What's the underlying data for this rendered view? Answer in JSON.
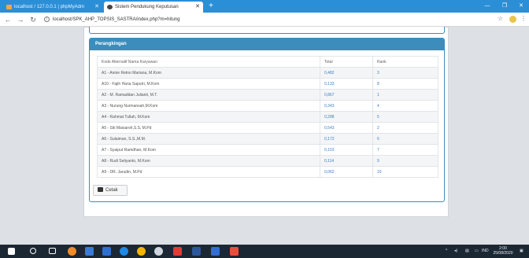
{
  "browser": {
    "tabs": [
      {
        "label": "localhost / 127.0.0.1 | phpMyAdm"
      },
      {
        "label": "Sistem Pendukung Keputusan"
      }
    ],
    "url": "localhost/SPK_AHP_TOPSIS_SASTRA/index.php?m=hitung"
  },
  "panel": {
    "title": "Perangkingan",
    "columns": [
      "Kode Alternatif Nama Karyawan",
      "Total",
      "Rank"
    ],
    "rows": [
      {
        "name": "A1 - Annie Retno Mariana, M.Kom",
        "total": "0,482",
        "rank": "3"
      },
      {
        "name": "A10 - Fajih Hana Saputri, M.Kom",
        "total": "0,133",
        "rank": "8"
      },
      {
        "name": "A2 - M. Ramaddan Julianti, M.T.",
        "total": "0,867",
        "rank": "1"
      },
      {
        "name": "A3 - Nurung Nurmansah,M.Kom",
        "total": "0,343",
        "rank": "4"
      },
      {
        "name": "A4 - Rahmat Tullah, M.Kom",
        "total": "0,288",
        "rank": "5"
      },
      {
        "name": "A5 - Siti Maisaroh,S.S, M.Pd",
        "total": "0,543",
        "rank": "2"
      },
      {
        "name": "A6 - Sulaiman, S.S.,M.M.",
        "total": "0,172",
        "rank": "6"
      },
      {
        "name": "A7 - Syaiput Ramdhan, M.Kom",
        "total": "0,153",
        "rank": "7"
      },
      {
        "name": "A8 - Rudi Setiyanto, M.Kom",
        "total": "0,114",
        "rank": "9"
      },
      {
        "name": "A9 - DR. Jarudin, M.Pd",
        "total": "0,062",
        "rank": "10"
      }
    ],
    "print_label": "Cetak"
  },
  "taskbar": {
    "lang": "IND",
    "time": "2:00",
    "date": "25/08/2020"
  },
  "colors": {
    "accent": "#3c8dbc",
    "tabbar": "#2b8fd8",
    "taskbar": "#1c2734"
  }
}
